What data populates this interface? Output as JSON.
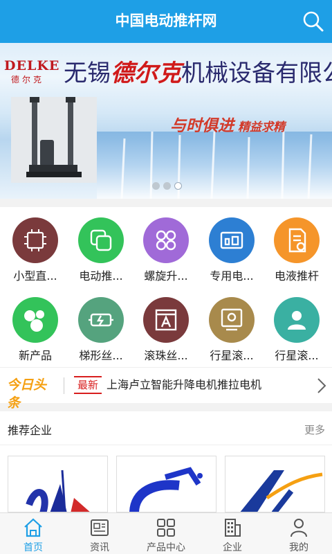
{
  "header": {
    "title": "中国电动推杆网",
    "search_icon": "search-icon"
  },
  "banner": {
    "logo_en": "DELKE",
    "logo_cn": "德尔克",
    "company_prefix": "无锡",
    "company_brand": "德尔克",
    "company_suffix": "机械设备有限公司",
    "slogan_main": "与时俱进",
    "slogan_sub": "精益求精",
    "slides_total": 3,
    "slide_active": 3
  },
  "categories": [
    {
      "label": "小型直...",
      "color": "#7a3a3c",
      "icon": "chip-icon"
    },
    {
      "label": "电动推...",
      "color": "#33c35a",
      "icon": "copy-icon"
    },
    {
      "label": "螺旋升...",
      "color": "#a06ad8",
      "icon": "grid-icon"
    },
    {
      "label": "专用电...",
      "color": "#2d7fd3",
      "icon": "device-icon"
    },
    {
      "label": "电液推杆",
      "color": "#f5952a",
      "icon": "document-icon"
    },
    {
      "label": "新产品",
      "color": "#33c35a",
      "icon": "bubbles-icon"
    },
    {
      "label": "梯形丝...",
      "color": "#55a37e",
      "icon": "motor-icon"
    },
    {
      "label": "滚珠丝...",
      "color": "#7a3a3c",
      "icon": "font-icon"
    },
    {
      "label": "行星滚...",
      "color": "#a88a4c",
      "icon": "monitor-icon"
    },
    {
      "label": "行星滚...",
      "color": "#3ab0a2",
      "icon": "user-icon"
    }
  ],
  "ticker": {
    "brand": "今日头条",
    "badge": "最新",
    "headline": "上海卢立智能升降电机推拉电机"
  },
  "recommended": {
    "title": "推荐企业",
    "more": "更多"
  },
  "tabbar": [
    {
      "label": "首页",
      "icon": "home-icon",
      "active": true
    },
    {
      "label": "资讯",
      "icon": "news-icon",
      "active": false
    },
    {
      "label": "产品中心",
      "icon": "apps-icon",
      "active": false
    },
    {
      "label": "企业",
      "icon": "building-icon",
      "active": false
    },
    {
      "label": "我的",
      "icon": "person-icon",
      "active": false
    }
  ],
  "colors": {
    "primary": "#1e9fe6",
    "ticker_brand": "#f5a012",
    "badge": "#d81e1e"
  }
}
